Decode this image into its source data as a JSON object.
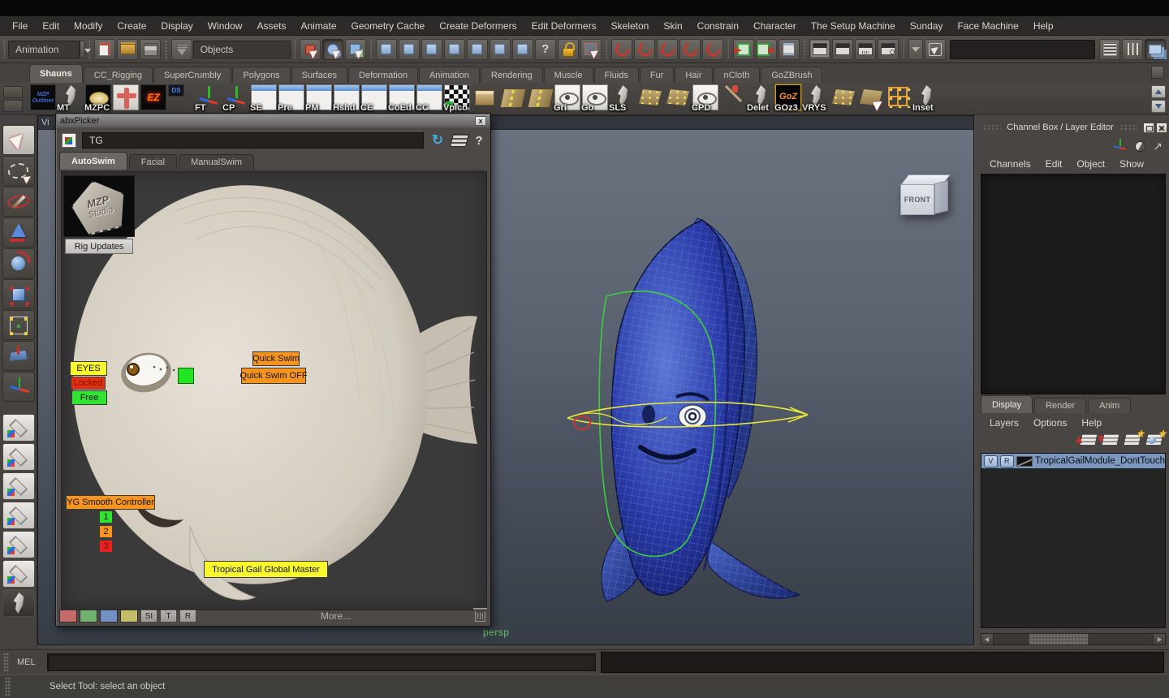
{
  "menu_bar": {
    "items": [
      "File",
      "Edit",
      "Modify",
      "Create",
      "Display",
      "Window",
      "Assets",
      "Animate",
      "Geometry Cache",
      "Create Deformers",
      "Edit Deformers",
      "Skeleton",
      "Skin",
      "Constrain",
      "Character",
      "The Setup Machine",
      "Sunday",
      "Face Machine",
      "Help"
    ]
  },
  "status_line": {
    "mode_dropdown": "Animation",
    "objects_filter": "Objects",
    "select_by_name_value": ""
  },
  "shelf": {
    "tabs": [
      {
        "label": "Shauns",
        "active": true
      },
      {
        "label": "CC_Rigging"
      },
      {
        "label": "SuperCrumbly"
      },
      {
        "label": "Polygons"
      },
      {
        "label": "Surfaces"
      },
      {
        "label": "Deformation"
      },
      {
        "label": "Animation"
      },
      {
        "label": "Rendering"
      },
      {
        "label": "Muscle"
      },
      {
        "label": "Fluids"
      },
      {
        "label": "Fur"
      },
      {
        "label": "Hair"
      },
      {
        "label": "nCloth"
      },
      {
        "label": "GoZBrush"
      }
    ],
    "items": [
      {
        "label": "",
        "icon": "tile-mzp",
        "icon_text": "MZP Outliner"
      },
      {
        "label": "MT",
        "icon": "feather",
        "icon_text": ""
      },
      {
        "label": "MZPC",
        "icon": "tile-oval",
        "icon_text": ""
      },
      {
        "label": "",
        "icon": "tile-redman",
        "icon_text": ""
      },
      {
        "label": "",
        "icon": "tile-ez",
        "icon_text": "EZ"
      },
      {
        "label": "",
        "icon": "tile-ds",
        "icon_text": "DS"
      },
      {
        "label": "FT",
        "icon": "axis",
        "icon_text": ""
      },
      {
        "label": "CP",
        "icon": "axis",
        "icon_text": ""
      },
      {
        "label": "SE",
        "icon": "window",
        "icon_text": ""
      },
      {
        "label": "Pre",
        "icon": "window",
        "icon_text": ""
      },
      {
        "label": "PM",
        "icon": "window",
        "icon_text": ""
      },
      {
        "label": "Hshd",
        "icon": "window",
        "icon_text": ""
      },
      {
        "label": "CE",
        "icon": "window",
        "icon_text": ""
      },
      {
        "label": "CoEd",
        "icon": "window",
        "icon_text": ""
      },
      {
        "label": "CC",
        "icon": "window",
        "icon_text": ""
      },
      {
        "label": "VpIco",
        "icon": "flag",
        "icon_text": ""
      },
      {
        "label": "",
        "icon": "box3d",
        "icon_text": ""
      },
      {
        "label": "",
        "icon": "road",
        "icon_text": ""
      },
      {
        "label": "",
        "icon": "road",
        "icon_text": ""
      },
      {
        "label": "Gri",
        "icon": "eye",
        "icon_text": ""
      },
      {
        "label": "Go",
        "icon": "eye",
        "icon_text": ""
      },
      {
        "label": "SLS",
        "icon": "feather",
        "icon_text": ""
      },
      {
        "label": "",
        "icon": "mesh",
        "icon_text": ""
      },
      {
        "label": "",
        "icon": "mesh",
        "icon_text": ""
      },
      {
        "label": "CPD",
        "icon": "eye",
        "icon_text": ""
      },
      {
        "label": "",
        "icon": "axe",
        "icon_text": ""
      },
      {
        "label": "Delet",
        "icon": "feather",
        "icon_text": ""
      },
      {
        "label": "GOz3",
        "icon": "tile-goz",
        "icon_text": "GoZ"
      },
      {
        "label": "VRYS",
        "icon": "feather",
        "icon_text": ""
      },
      {
        "label": "",
        "icon": "mesh",
        "icon_text": ""
      },
      {
        "label": "",
        "icon": "meshcursor",
        "icon_text": ""
      },
      {
        "label": "",
        "icon": "lattice",
        "icon_text": ""
      },
      {
        "label": "Inset",
        "icon": "feather",
        "icon_text": ""
      }
    ]
  },
  "toolbox": {
    "tools": [
      {
        "id": "select",
        "active": true
      },
      {
        "id": "lasso"
      },
      {
        "id": "paint-select"
      },
      {
        "id": "move"
      },
      {
        "id": "rotate"
      },
      {
        "id": "scale"
      },
      {
        "id": "universal-manipulator"
      },
      {
        "id": "soft-modification"
      },
      {
        "id": "show-manipulator"
      }
    ],
    "layouts": [
      {
        "id": "single-pane"
      },
      {
        "id": "four-pane"
      },
      {
        "id": "outliner-persp"
      },
      {
        "id": "persp-graph"
      },
      {
        "id": "hypershade-persp"
      },
      {
        "id": "persp-trax"
      },
      {
        "id": "mzp"
      }
    ]
  },
  "picker": {
    "title": "abxPicker",
    "close_label": "x",
    "namespace_value": "TG",
    "help_label": "?",
    "tabs": [
      {
        "label": "AutoSwim",
        "active": true
      },
      {
        "label": "Facial"
      },
      {
        "label": "ManualSwim"
      }
    ],
    "logo": {
      "line1": "MZP",
      "line2": "Studio"
    },
    "buttons": {
      "rig_updates": "Rig Updates",
      "eyes": "EYES",
      "locked": "Locked",
      "free": "Free",
      "quick_swim": "Quick Swim",
      "quick_swim_off": "Quick Swim OFF",
      "yg_smooth": "YG Smooth Controller",
      "one": "1",
      "two": "2",
      "three": "3",
      "global_master": "Tropical Gail Global Master"
    },
    "bottom": {
      "si": "SI",
      "t": "T",
      "r": "R",
      "more": "More..."
    },
    "colors": {
      "orange": "#f7941d",
      "yellow": "#f8f82c",
      "green": "#30e430",
      "red": "#e82020"
    }
  },
  "viewport": {
    "camera_label": "persp",
    "view_cube": {
      "front": "FRONT"
    },
    "clipped_panel_menu": "Vi"
  },
  "channel_box": {
    "title": "Channel Box / Layer Editor",
    "menus": [
      "Channels",
      "Edit",
      "Object",
      "Show"
    ],
    "layer_editor": {
      "tabs": [
        {
          "label": "Display",
          "active": true
        },
        {
          "label": "Render"
        },
        {
          "label": "Anim"
        }
      ],
      "menus": [
        "Layers",
        "Options",
        "Help"
      ],
      "layers": [
        {
          "visible_label": "V",
          "renderable_label": "R",
          "name": "TropicalGailModule_DontTouch",
          "selected": true
        }
      ]
    }
  },
  "command_line": {
    "label": "MEL",
    "input_value": "",
    "result_value": ""
  },
  "help_line": {
    "text": "Select Tool: select an object"
  }
}
